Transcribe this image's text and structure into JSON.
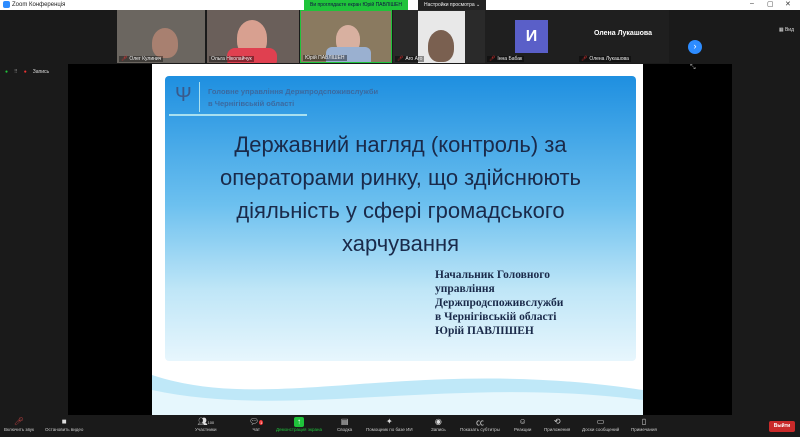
{
  "window": {
    "title": "Zoom Конференція",
    "minimize": "–",
    "maximize": "▢",
    "close": "✕"
  },
  "banner": {
    "viewing": "Ви проглядаєте екран Юрій ПАВЛІШЕН",
    "view_options": "Настройки просмотра ⌄"
  },
  "participants": [
    {
      "name": "Олег Кулинич",
      "muted": true
    },
    {
      "name": "Ольга Ніколайчук",
      "muted": false
    },
    {
      "name": "Юрій ПАВЛІШЕН",
      "muted": false
    },
    {
      "name": "Аго Аго",
      "muted": true
    },
    {
      "name": "Інна Бабак",
      "muted": true,
      "initial": "И"
    },
    {
      "name": "Олена Лукашова",
      "muted": true,
      "display": "Олена Лукашова"
    }
  ],
  "view_label": "Вид",
  "status": {
    "recording": "Запись"
  },
  "slide": {
    "org": [
      "Головне управління Держпродспоживслужби",
      "в Чернігівській області"
    ],
    "title": [
      "Державний нагляд (контроль) за",
      "операторами ринку, що здійснюють",
      "діяльність у сфері громадського",
      "харчування"
    ],
    "author": [
      "Начальник Головного",
      "управління",
      "Держпродспоживслужби",
      "в Чернігівській області",
      "Юрій ПАВЛІШЕН"
    ]
  },
  "toolbar": {
    "unmute": "Включить звук",
    "video": "Остановить видео",
    "participants": "Участники",
    "participant_count": "100",
    "chat": "Чат",
    "chat_badge": "1",
    "share": "Демонстрация экрана",
    "summary": "Сводка",
    "companion": "Помощник по базе ИИ",
    "record": "Запись",
    "captions": "Показать субтитры",
    "reactions": "Реакции",
    "apps": "Приложения",
    "whiteboards": "Доски сообщений",
    "notes": "Примечания",
    "leave": "Выйти"
  },
  "colors": {
    "share": "#1fc33b",
    "leave": "#c92a2a",
    "accent": "#2d8cff"
  }
}
